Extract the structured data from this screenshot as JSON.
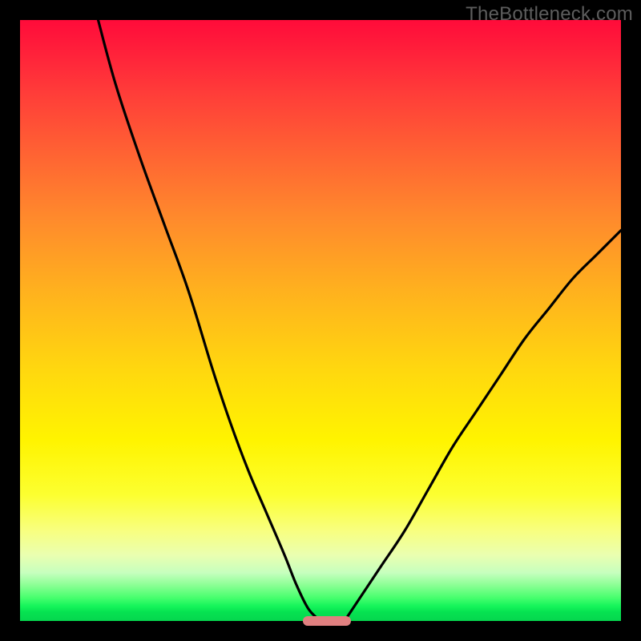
{
  "attribution": "TheBottleneck.com",
  "colors": {
    "frame": "#000000",
    "gradient_top": "#ff0b3a",
    "gradient_mid": "#fff400",
    "gradient_bottom": "#05d64e",
    "curve": "#000000",
    "marker": "#e08080"
  },
  "chart_data": {
    "type": "line",
    "title": "",
    "xlabel": "",
    "ylabel": "",
    "xlim": [
      0,
      100
    ],
    "ylim": [
      0,
      100
    ],
    "series": [
      {
        "name": "left-branch",
        "x": [
          13,
          16,
          20,
          24,
          28,
          32,
          35,
          38,
          41,
          44,
          46,
          48,
          50
        ],
        "y": [
          100,
          89,
          77,
          66,
          55,
          42,
          33,
          25,
          18,
          11,
          6,
          2,
          0
        ]
      },
      {
        "name": "right-branch",
        "x": [
          54,
          56,
          60,
          64,
          68,
          72,
          76,
          80,
          84,
          88,
          92,
          96,
          100
        ],
        "y": [
          0,
          3,
          9,
          15,
          22,
          29,
          35,
          41,
          47,
          52,
          57,
          61,
          65
        ]
      }
    ],
    "marker": {
      "x_start": 47,
      "x_end": 55,
      "y": 0
    }
  }
}
